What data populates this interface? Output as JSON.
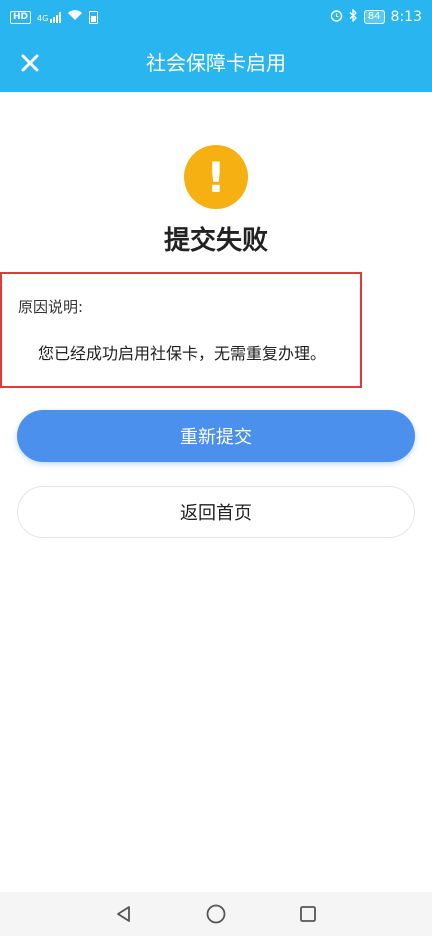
{
  "status_bar": {
    "hd_badge": "HD",
    "network_label": "4G",
    "battery_level": "84",
    "time": "8:13"
  },
  "header": {
    "close_icon": "close-icon",
    "title": "社会保障卡启用"
  },
  "result": {
    "icon": "warning-icon",
    "icon_color": "#f6b012",
    "title": "提交失败"
  },
  "reason": {
    "label": "原因说明:",
    "text": "您已经成功启用社保卡，无需重复办理。",
    "border_color": "#e13a3a"
  },
  "actions": {
    "resubmit_label": "重新提交",
    "home_label": "返回首页"
  },
  "nav_bar": {
    "back_icon": "back-triangle-icon",
    "home_icon": "home-circle-icon",
    "recents_icon": "recents-square-icon"
  },
  "colors": {
    "accent": "#29b6f0",
    "primary_button": "#4a90ec"
  }
}
